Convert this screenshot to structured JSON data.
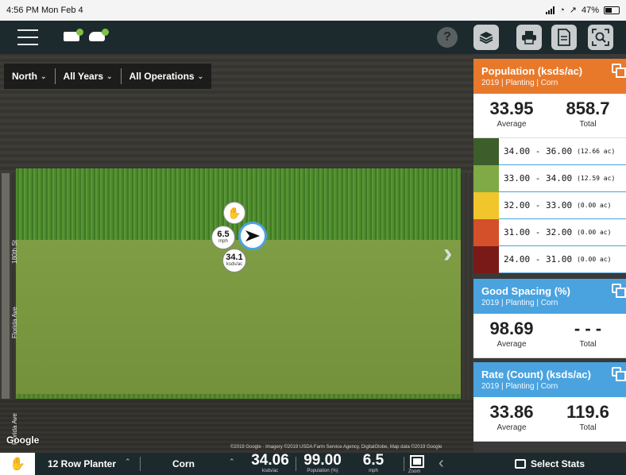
{
  "status": {
    "time": "4:56 PM  Mon Feb 4",
    "battery": "47%"
  },
  "topbar": {
    "icons": [
      "menu-icon",
      "device-status-icon",
      "cloud-sync-icon",
      "help-icon",
      "layers-icon",
      "print-icon",
      "document-icon",
      "zoom-extent-icon"
    ],
    "help_glyph": "?"
  },
  "filters": {
    "direction": "North",
    "years": "All Years",
    "operations": "All Operations"
  },
  "map": {
    "road_labels": [
      "180th St",
      "Florida Ave",
      "Florida Ave"
    ],
    "google": "Google",
    "copyright": "©2019 Google · Imagery ©2019 USDA Farm Service Agency, DigitalGlobe, Map data ©2019 Google",
    "speed_value": "6.5",
    "speed_unit": "mph",
    "rate_value": "34.1",
    "rate_unit": "ksds/ac"
  },
  "cards": {
    "population": {
      "title": "Population (ksds/ac)",
      "subtitle": "2019 | Planting | Corn",
      "color": "#e8792b",
      "average": "33.95",
      "average_label": "Average",
      "total": "858.7",
      "total_label": "Total",
      "legend": [
        {
          "range": "34.00 - 36.00",
          "acres": "(12.66 ac)",
          "color": "#3d5e2a"
        },
        {
          "range": "33.00 - 34.00",
          "acres": "(12.59 ac)",
          "color": "#7faa45"
        },
        {
          "range": "32.00 - 33.00",
          "acres": "(0.00 ac)",
          "color": "#f0c62c"
        },
        {
          "range": "31.00 - 32.00",
          "acres": "(0.00 ac)",
          "color": "#d4502a"
        },
        {
          "range": "24.00 - 31.00",
          "acres": "(0.00 ac)",
          "color": "#7a1a18"
        }
      ]
    },
    "spacing": {
      "title": "Good Spacing (%)",
      "subtitle": "2019 | Planting | Corn",
      "color": "#4aa3df",
      "average": "98.69",
      "average_label": "Average",
      "total": "- - -",
      "total_label": "Total"
    },
    "rate": {
      "title": "Rate (Count) (ksds/ac)",
      "subtitle": "2019 | Planting | Corn",
      "color": "#4aa3df",
      "average": "33.86",
      "average_label": "Average",
      "total": "119.6",
      "total_label": "Total"
    }
  },
  "bottombar": {
    "implement": "12 Row Planter",
    "crop": "Corn",
    "metrics": [
      {
        "value": "34.06",
        "unit": "ksds/ac"
      },
      {
        "value": "99.00",
        "unit": "Population (%)"
      },
      {
        "value": "6.5",
        "unit": "mph"
      }
    ],
    "zoom_label": "Zoom",
    "select_stats": "Select Stats"
  }
}
